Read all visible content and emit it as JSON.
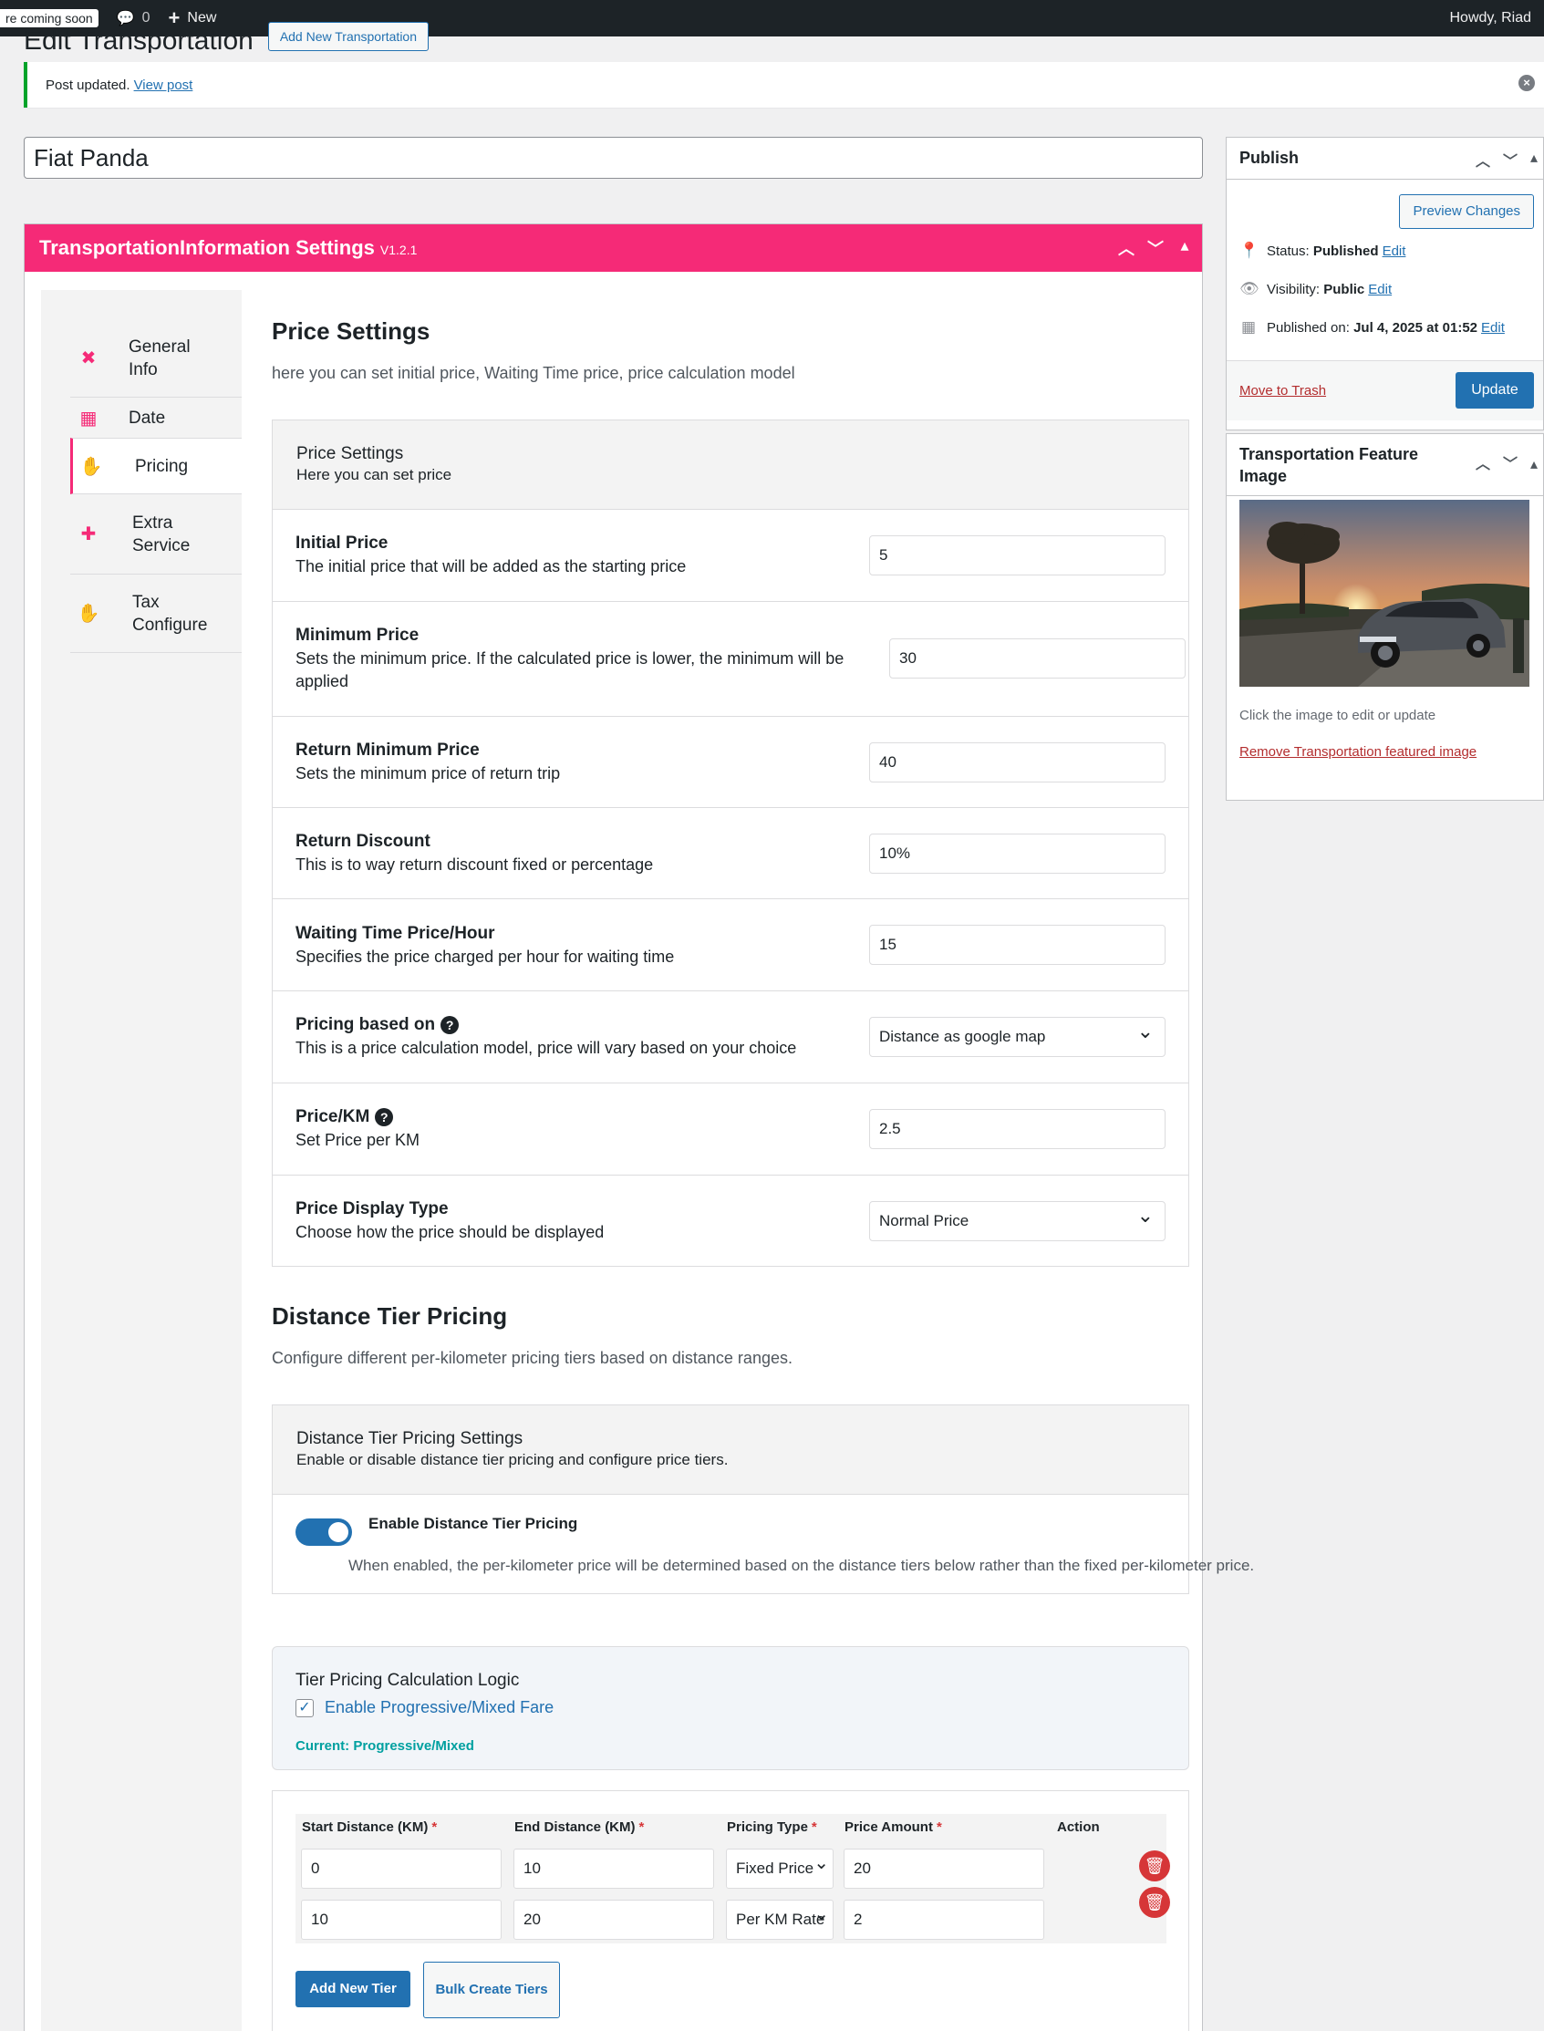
{
  "admin_bar": {
    "coming_soon": "re coming soon",
    "comments_count": "0",
    "new_label": "New",
    "greeting": "Howdy, Riad"
  },
  "page": {
    "title": "Edit Transportation",
    "add_new_label": "Add New Transportation"
  },
  "notice": {
    "text": "Post updated.",
    "link": "View post"
  },
  "post_title": "Fiat Panda",
  "metabox": {
    "title": "TransportationInformation Settings",
    "version": "V1.2.1",
    "tabs": [
      {
        "label_line1": "General",
        "label_line2": "Info",
        "icon": "tools-icon"
      },
      {
        "label_line1": "Date",
        "label_line2": "",
        "icon": "calendar-icon"
      },
      {
        "label_line1": "Pricing",
        "label_line2": "",
        "icon": "money-hand-icon"
      },
      {
        "label_line1": "Extra",
        "label_line2": "Service",
        "icon": "puzzle-icon"
      },
      {
        "label_line1": "Tax",
        "label_line2": "Configure",
        "icon": "money-hand-icon"
      }
    ],
    "active_tab": "Pricing"
  },
  "price_settings": {
    "title": "Price Settings",
    "description": "here you can set initial price, Waiting Time price, price calculation model",
    "panel_title": "Price Settings",
    "panel_desc": "Here you can set price",
    "rows": [
      {
        "label": "Initial Price",
        "desc": "The initial price that will be added as the starting price",
        "value": "5"
      },
      {
        "label": "Minimum Price",
        "desc_line1": "Sets the minimum price. If the calculated price is lower, the minimum will be",
        "desc_line2": "applied",
        "value": "30"
      },
      {
        "label": "Return Minimum Price",
        "desc": "Sets the minimum price of return trip",
        "value": "40"
      },
      {
        "label": "Return Discount",
        "desc": "This is to way return discount fixed or percentage",
        "value": "10%"
      },
      {
        "label": "Waiting Time Price/Hour",
        "desc": "Specifies the price charged per hour for waiting time",
        "value": "15"
      },
      {
        "label": "Pricing based on",
        "desc": "This is a price calculation model, price will vary based on your choice",
        "value": "Distance as google map"
      },
      {
        "label": "Price/KM",
        "desc": "Set Price per KM",
        "value": "2.5"
      },
      {
        "label": "Price Display Type",
        "desc": "Choose how the price should be displayed",
        "value": "Normal Price"
      }
    ]
  },
  "tier_pricing": {
    "title": "Distance Tier Pricing",
    "description": "Configure different per-kilometer pricing tiers based on distance ranges.",
    "panel_title": "Distance Tier Pricing Settings",
    "panel_desc": "Enable or disable distance tier pricing and configure price tiers.",
    "toggle_label": "Enable Distance Tier Pricing",
    "toggle_on": true,
    "toggle_desc": "When enabled, the per-kilometer price will be determined based on the distance tiers below rather than the fixed per-kilometer price.",
    "logic_title": "Tier Pricing Calculation Logic",
    "logic_checkbox": "Enable Progressive/Mixed Fare",
    "logic_current": "Current: Progressive/Mixed",
    "columns": [
      "Start Distance (KM)",
      "End Distance (KM)",
      "Pricing Type",
      "Price Amount",
      "Action"
    ],
    "rows": [
      {
        "start": "0",
        "end": "10",
        "type": "Fixed Price",
        "amount": "20"
      },
      {
        "start": "10",
        "end": "20",
        "type": "Per KM Rate",
        "amount": "2"
      }
    ],
    "add_button": "Add New Tier",
    "bulk_button": "Bulk Create Tiers"
  },
  "publish": {
    "title": "Publish",
    "preview_button": "Preview Changes",
    "status_label": "Status:",
    "status_value": "Published",
    "visibility_label": "Visibility:",
    "visibility_value": "Public",
    "published_label": "Published on:",
    "published_value": "Jul 4, 2025 at 01:52",
    "edit_link": "Edit",
    "trash_link": "Move to Trash",
    "update_button": "Update"
  },
  "feature_image": {
    "title_line1": "Transportation Feature",
    "title_line2": "Image",
    "caption": "Click the image to edit or update",
    "remove_link": "Remove Transportation featured image"
  },
  "colors": {
    "accent": "#f52a77",
    "primary": "#2271b1",
    "danger": "#d63638"
  }
}
